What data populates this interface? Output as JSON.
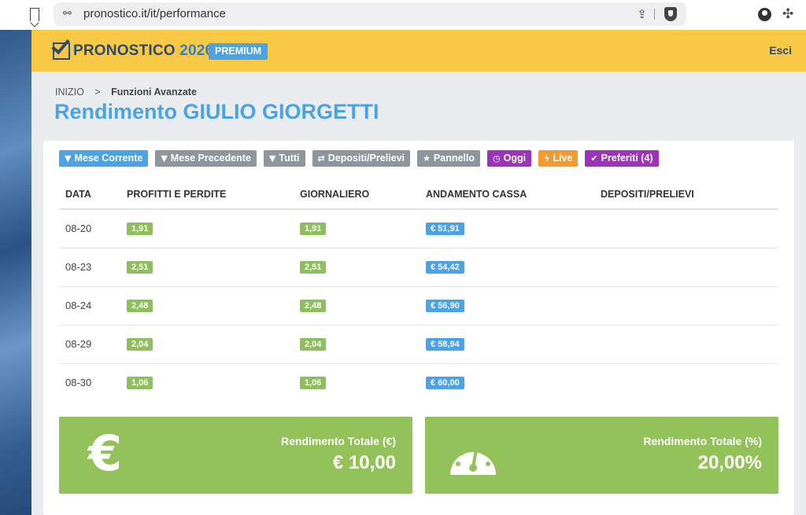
{
  "browser": {
    "url": "pronostico.it/it/performance"
  },
  "header": {
    "logo_text": "PRONOSTICO",
    "logo_year": "2026",
    "badge": "PREMIUM",
    "logout": "Esci",
    "colors": {
      "header_bg": "#f6c843",
      "logo": "#2f4a6a",
      "accent": "#4aa3e6"
    }
  },
  "breadcrumb": {
    "home": "INIZIO",
    "separator": ">",
    "current": "Funzioni Avanzate"
  },
  "title": {
    "prefix": "Rendimento",
    "name": "GIULIO GIORGETTI"
  },
  "filters": [
    {
      "label": "Mese Corrente",
      "icon": "filter-icon",
      "color": "#4aa3e6"
    },
    {
      "label": "Mese Precedente",
      "icon": "filter-icon",
      "color": "#8d969d"
    },
    {
      "label": "Tutti",
      "icon": "filter-icon",
      "color": "#8d969d"
    },
    {
      "label": "Depositi/Prelievi",
      "icon": "swap-icon",
      "color": "#8d969d"
    },
    {
      "label": "Pannello",
      "icon": "star-icon",
      "color": "#8d969d"
    },
    {
      "label": "Oggi",
      "icon": "clock-icon",
      "color": "#9b34b8"
    },
    {
      "label": "Live",
      "icon": "bolt-icon",
      "color": "#f29a30"
    },
    {
      "label": "Preferiti (4)",
      "icon": "check-icon",
      "color": "#9b34b8"
    }
  ],
  "table": {
    "headers": [
      "DATA",
      "PROFITTI E PERDITE",
      "GIORNALIERO",
      "ANDAMENTO CASSA",
      "DEPOSITI/PRELIEVI"
    ],
    "rows": [
      {
        "date": "08-20",
        "profit": "1,91",
        "daily": "1,91",
        "cash": "€ 51,91",
        "deposits": ""
      },
      {
        "date": "08-23",
        "profit": "2,51",
        "daily": "2,51",
        "cash": "€ 54,42",
        "deposits": ""
      },
      {
        "date": "08-24",
        "profit": "2,48",
        "daily": "2,48",
        "cash": "€ 56,90",
        "deposits": ""
      },
      {
        "date": "08-29",
        "profit": "2,04",
        "daily": "2,04",
        "cash": "€ 58,94",
        "deposits": ""
      },
      {
        "date": "08-30",
        "profit": "1,06",
        "daily": "1,06",
        "cash": "€ 60,00",
        "deposits": ""
      }
    ]
  },
  "stats": {
    "euro": {
      "label": "Rendimento Totale (€)",
      "value": "€ 10,00",
      "icon": "euro-icon"
    },
    "percent": {
      "label": "Rendimento Totale (%)",
      "value": "20,00%",
      "icon": "gauge-icon"
    },
    "color": "#93c15a"
  }
}
